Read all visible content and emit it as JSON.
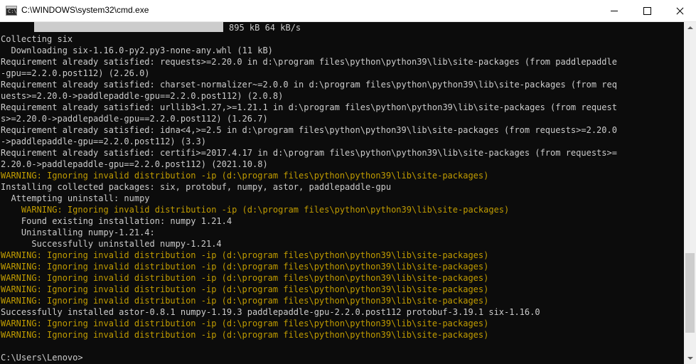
{
  "window": {
    "title": "C:\\WINDOWS\\system32\\cmd.exe",
    "icon": "cmd-icon",
    "icon_glyph": "C:\\",
    "controls": [
      "minimize-icon",
      "maximize-icon",
      "close-icon"
    ]
  },
  "progress": {
    "fraction": 1.0,
    "text": "895 kB 64 kB/s"
  },
  "scrollbar": {
    "position_fraction": 0.92,
    "visible_fraction": 0.25
  },
  "colors": {
    "background": "#0c0c0c",
    "text": "#cccccc",
    "warning": "#c19c00"
  },
  "console": {
    "lines": [
      {
        "text": "Collecting six",
        "type": "normal"
      },
      {
        "text": "  Downloading six-1.16.0-py2.py3-none-any.whl (11 kB)",
        "type": "normal"
      },
      {
        "text": "Requirement already satisfied: requests>=2.20.0 in d:\\program files\\python\\python39\\lib\\site-packages (from paddlepaddle",
        "type": "normal"
      },
      {
        "text": "-gpu==2.2.0.post112) (2.26.0)",
        "type": "normal"
      },
      {
        "text": "Requirement already satisfied: charset-normalizer~=2.0.0 in d:\\program files\\python\\python39\\lib\\site-packages (from req",
        "type": "normal"
      },
      {
        "text": "uests>=2.20.0->paddlepaddle-gpu==2.2.0.post112) (2.0.8)",
        "type": "normal"
      },
      {
        "text": "Requirement already satisfied: urllib3<1.27,>=1.21.1 in d:\\program files\\python\\python39\\lib\\site-packages (from request",
        "type": "normal"
      },
      {
        "text": "s>=2.20.0->paddlepaddle-gpu==2.2.0.post112) (1.26.7)",
        "type": "normal"
      },
      {
        "text": "Requirement already satisfied: idna<4,>=2.5 in d:\\program files\\python\\python39\\lib\\site-packages (from requests>=2.20.0",
        "type": "normal"
      },
      {
        "text": "->paddlepaddle-gpu==2.2.0.post112) (3.3)",
        "type": "normal"
      },
      {
        "text": "Requirement already satisfied: certifi>=2017.4.17 in d:\\program files\\python\\python39\\lib\\site-packages (from requests>=",
        "type": "normal"
      },
      {
        "text": "2.20.0->paddlepaddle-gpu==2.2.0.post112) (2021.10.8)",
        "type": "normal"
      },
      {
        "text": "WARNING: Ignoring invalid distribution -ip (d:\\program files\\python\\python39\\lib\\site-packages)",
        "type": "warning"
      },
      {
        "text": "Installing collected packages: six, protobuf, numpy, astor, paddlepaddle-gpu",
        "type": "normal"
      },
      {
        "text": "  Attempting uninstall: numpy",
        "type": "normal"
      },
      {
        "text": "    WARNING: Ignoring invalid distribution -ip (d:\\program files\\python\\python39\\lib\\site-packages)",
        "type": "warning"
      },
      {
        "text": "    Found existing installation: numpy 1.21.4",
        "type": "normal"
      },
      {
        "text": "    Uninstalling numpy-1.21.4:",
        "type": "normal"
      },
      {
        "text": "      Successfully uninstalled numpy-1.21.4",
        "type": "normal"
      },
      {
        "text": "WARNING: Ignoring invalid distribution -ip (d:\\program files\\python\\python39\\lib\\site-packages)",
        "type": "warning"
      },
      {
        "text": "WARNING: Ignoring invalid distribution -ip (d:\\program files\\python\\python39\\lib\\site-packages)",
        "type": "warning"
      },
      {
        "text": "WARNING: Ignoring invalid distribution -ip (d:\\program files\\python\\python39\\lib\\site-packages)",
        "type": "warning"
      },
      {
        "text": "WARNING: Ignoring invalid distribution -ip (d:\\program files\\python\\python39\\lib\\site-packages)",
        "type": "warning"
      },
      {
        "text": "WARNING: Ignoring invalid distribution -ip (d:\\program files\\python\\python39\\lib\\site-packages)",
        "type": "warning"
      },
      {
        "text": "Successfully installed astor-0.8.1 numpy-1.19.3 paddlepaddle-gpu-2.2.0.post112 protobuf-3.19.1 six-1.16.0",
        "type": "normal"
      },
      {
        "text": "WARNING: Ignoring invalid distribution -ip (d:\\program files\\python\\python39\\lib\\site-packages)",
        "type": "warning"
      },
      {
        "text": "WARNING: Ignoring invalid distribution -ip (d:\\program files\\python\\python39\\lib\\site-packages)",
        "type": "warning"
      },
      {
        "text": "",
        "type": "normal"
      },
      {
        "text": "C:\\Users\\Lenovo>",
        "type": "prompt"
      }
    ]
  }
}
